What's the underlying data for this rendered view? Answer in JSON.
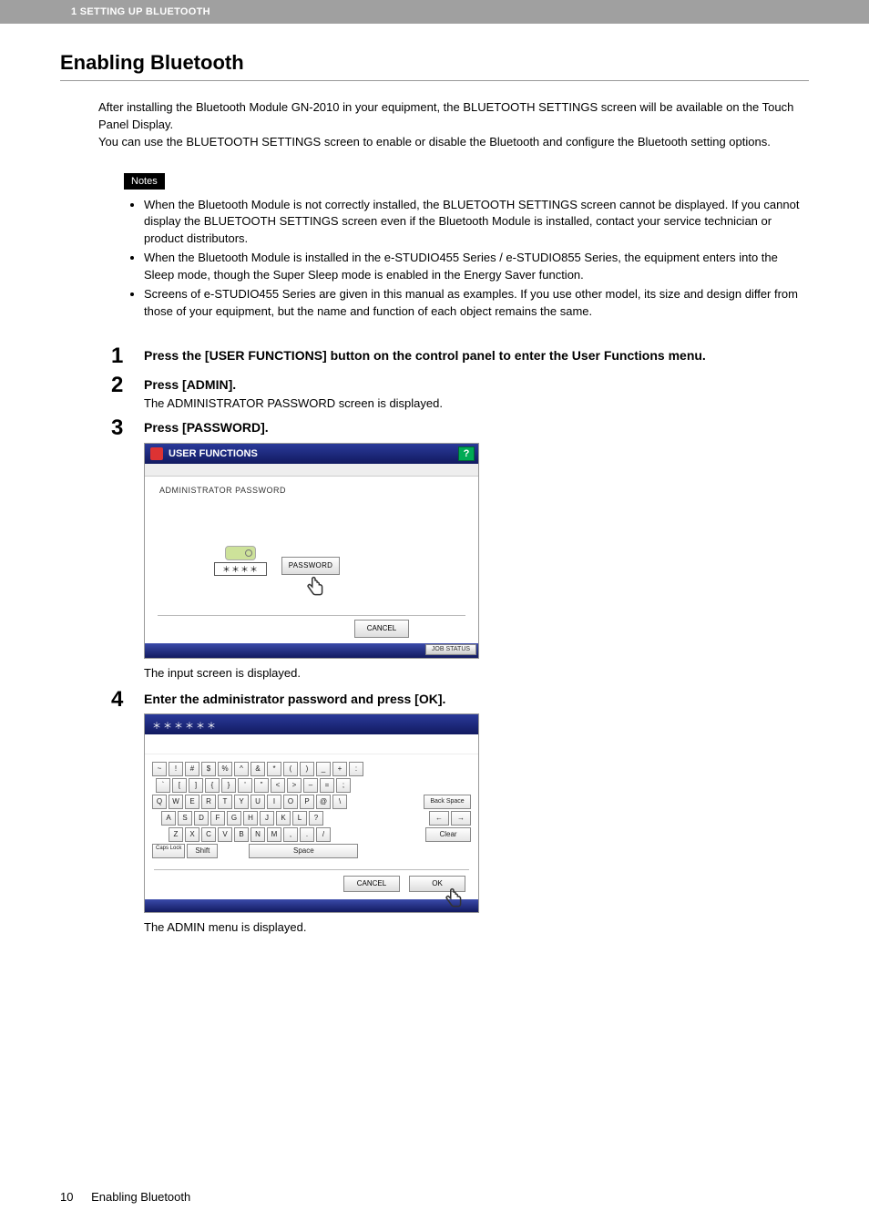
{
  "header": {
    "chapter": "1 SETTING UP BLUETOOTH"
  },
  "title": "Enabling Bluetooth",
  "intro": [
    "After installing the Bluetooth Module GN-2010 in your equipment, the BLUETOOTH SETTINGS screen will be available on the Touch Panel Display.",
    "You can use the BLUETOOTH SETTINGS screen to enable or disable the Bluetooth and configure the Bluetooth setting options."
  ],
  "notes": {
    "label": "Notes",
    "items": [
      "When the Bluetooth Module is not correctly installed, the BLUETOOTH SETTINGS screen cannot be displayed. If you cannot display the BLUETOOTH SETTINGS screen even if the Bluetooth Module is installed, contact your service technician or product distributors.",
      "When the Bluetooth Module is installed in the e-STUDIO455 Series / e-STUDIO855 Series, the equipment enters into the Sleep mode, though the Super Sleep mode is enabled in the Energy Saver function.",
      "Screens of e-STUDIO455 Series are given in this manual as examples. If you use other model, its size and design differ from those of your equipment, but the name and function of each object remains the same."
    ]
  },
  "steps": {
    "s1": {
      "num": "1",
      "title": "Press the [USER FUNCTIONS] button on the control panel to enter the User Functions menu."
    },
    "s2": {
      "num": "2",
      "title": "Press [ADMIN].",
      "sub": "The ADMINISTRATOR PASSWORD screen is displayed."
    },
    "s3": {
      "num": "3",
      "title": "Press [PASSWORD].",
      "caption": "The input screen is displayed."
    },
    "s4": {
      "num": "4",
      "title": "Enter the administrator password and press [OK].",
      "caption": "The ADMIN menu is displayed."
    }
  },
  "screen1": {
    "titlebar": "USER FUNCTIONS",
    "help": "?",
    "label": "ADMINISTRATOR PASSWORD",
    "pwd_mask": "＊＊＊＊",
    "pwd_button": "PASSWORD",
    "cancel": "CANCEL",
    "jobstatus": "JOB STATUS"
  },
  "screen2": {
    "mask": "＊＊＊＊＊＊",
    "keys_row1": [
      "~",
      "!",
      "#",
      "$",
      "%",
      "^",
      "&",
      "*",
      "(",
      ")",
      "_",
      "+",
      ":"
    ],
    "keys_row2": [
      "`",
      "[",
      "]",
      "{",
      "}",
      "'",
      "\"",
      "<",
      ">",
      "–",
      "=",
      ";"
    ],
    "keys_row3": [
      "Q",
      "W",
      "E",
      "R",
      "T",
      "Y",
      "U",
      "I",
      "O",
      "P",
      "@",
      "\\"
    ],
    "keys_row4": [
      "A",
      "S",
      "D",
      "F",
      "G",
      "H",
      "J",
      "K",
      "L",
      "?"
    ],
    "keys_row5": [
      "Z",
      "X",
      "C",
      "V",
      "B",
      "N",
      "M",
      ",",
      ".",
      "/"
    ],
    "backspace": "Back Space",
    "arrow_left": "←",
    "arrow_right": "→",
    "clear": "Clear",
    "caps": "Caps Lock",
    "shift": "Shift",
    "space": "Space",
    "cancel": "CANCEL",
    "ok": "OK"
  },
  "footer": {
    "page": "10",
    "title": "Enabling Bluetooth"
  }
}
